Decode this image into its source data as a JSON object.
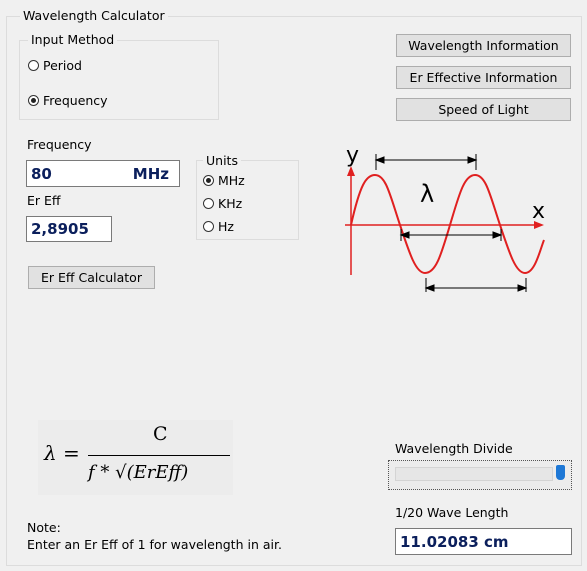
{
  "window": {
    "title": "Wavelength Calculator"
  },
  "input_method": {
    "title": "Input Method",
    "options": [
      {
        "label": "Period",
        "checked": false
      },
      {
        "label": "Frequency",
        "checked": true
      }
    ]
  },
  "buttons": {
    "wavelength_info": "Wavelength Information",
    "er_effective_info": "Er Effective Information",
    "speed_of_light": "Speed of Light",
    "er_eff_calculator": "Er Eff Calculator"
  },
  "frequency": {
    "label": "Frequency",
    "value": "80",
    "unit": "MHz"
  },
  "er_eff": {
    "label": "Er Eff",
    "value": "2,8905"
  },
  "units": {
    "title": "Units",
    "options": [
      {
        "label": "MHz",
        "checked": true
      },
      {
        "label": "KHz",
        "checked": false
      },
      {
        "label": "Hz",
        "checked": false
      }
    ]
  },
  "diagram": {
    "y_label": "y",
    "x_label": "x",
    "lambda_label": "λ",
    "wave_color": "#e02020",
    "arrow_color": "#000000"
  },
  "formula": {
    "lhs": "λ =",
    "numerator": "C",
    "denominator": "f * √(ErEff)"
  },
  "wavelength_divide": {
    "label": "Wavelength Divide",
    "slider_value": 1.0
  },
  "result": {
    "label": "1/20 Wave Length",
    "value": "11.02083 cm"
  },
  "note": {
    "title": "Note:",
    "text": "Enter an Er Eff of 1 for wavelength in air."
  }
}
